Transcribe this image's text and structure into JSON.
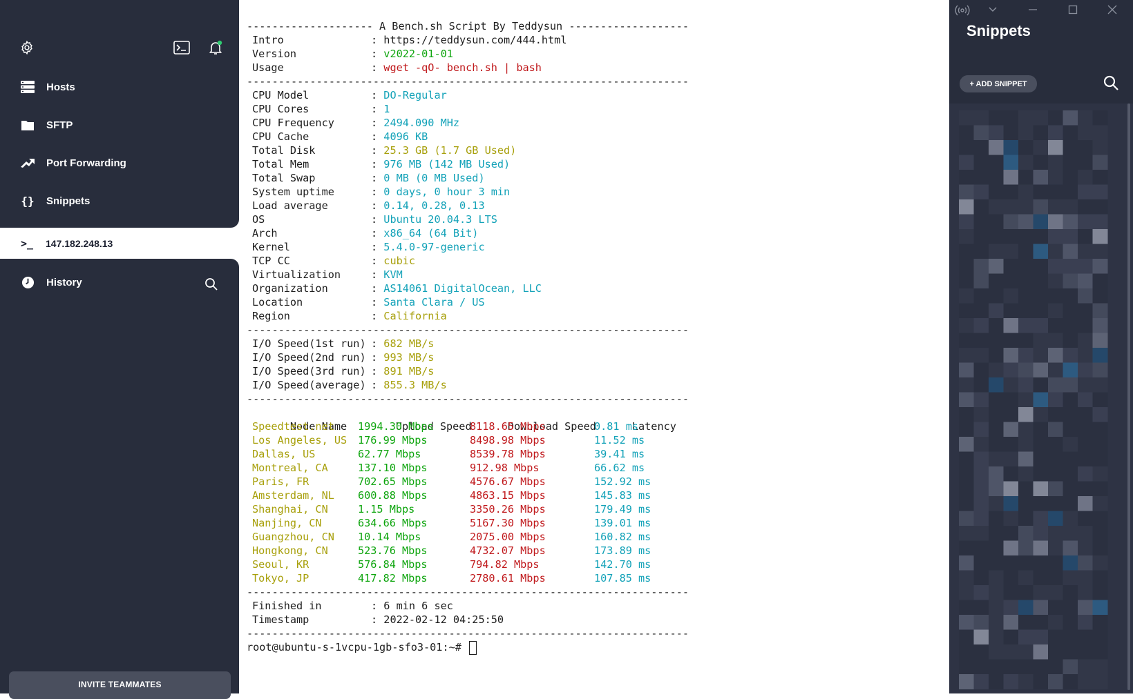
{
  "sidebar": {
    "nav": {
      "hosts": "Hosts",
      "sftp": "SFTP",
      "port_forwarding": "Port Forwarding",
      "snippets": "Snippets",
      "history": "History"
    },
    "active_host": "147.182.248.13",
    "invite_label": "INVITE TEAMMATES",
    "notification_dot_color": "#2ecc71"
  },
  "terminal": {
    "header": "-------------------- A Bench.sh Script By Teddysun -------------------",
    "separator": "----------------------------------------------------------------------",
    "intro": [
      {
        "key": "Intro",
        "value": "https://teddysun.com/444.html",
        "color": "dark"
      },
      {
        "key": "Version",
        "value": "v2022-01-01",
        "color": "green"
      },
      {
        "key": "Usage",
        "value": "wget -qO- bench.sh | bash",
        "color": "red"
      }
    ],
    "system": [
      {
        "key": "CPU Model",
        "value": "DO-Regular",
        "color": "cyan"
      },
      {
        "key": "CPU Cores",
        "value": "1",
        "color": "cyan"
      },
      {
        "key": "CPU Frequency",
        "value": "2494.090 MHz",
        "color": "cyan"
      },
      {
        "key": "CPU Cache",
        "value": "4096 KB",
        "color": "cyan"
      },
      {
        "key": "Total Disk",
        "value": "25.3 GB (1.7 GB Used)",
        "color": "yellow"
      },
      {
        "key": "Total Mem",
        "value": "976 MB (142 MB Used)",
        "color": "cyan"
      },
      {
        "key": "Total Swap",
        "value": "0 MB (0 MB Used)",
        "color": "cyan"
      },
      {
        "key": "System uptime",
        "value": "0 days, 0 hour 3 min",
        "color": "cyan"
      },
      {
        "key": "Load average",
        "value": "0.14, 0.28, 0.13",
        "color": "cyan"
      },
      {
        "key": "OS",
        "value": "Ubuntu 20.04.3 LTS",
        "color": "cyan"
      },
      {
        "key": "Arch",
        "value": "x86_64 (64 Bit)",
        "color": "cyan"
      },
      {
        "key": "Kernel",
        "value": "5.4.0-97-generic",
        "color": "cyan"
      },
      {
        "key": "TCP CC",
        "value": "cubic",
        "color": "yellow"
      },
      {
        "key": "Virtualization",
        "value": "KVM",
        "color": "cyan"
      },
      {
        "key": "Organization",
        "value": "AS14061 DigitalOcean, LLC",
        "color": "cyan"
      },
      {
        "key": "Location",
        "value": "Santa Clara / US",
        "color": "cyan"
      },
      {
        "key": "Region",
        "value": "California",
        "color": "yellow"
      }
    ],
    "io": [
      {
        "key": "I/O Speed(1st run)",
        "value": "682 MB/s",
        "color": "yellow"
      },
      {
        "key": "I/O Speed(2nd run)",
        "value": "993 MB/s",
        "color": "yellow"
      },
      {
        "key": "I/O Speed(3rd run)",
        "value": "891 MB/s",
        "color": "yellow"
      },
      {
        "key": "I/O Speed(average)",
        "value": "855.3 MB/s",
        "color": "yellow"
      }
    ],
    "speed_headers": [
      "Node Name",
      "Upload Speed",
      "Download Speed",
      "Latency"
    ],
    "speed_rows": [
      [
        "Speedtest.net",
        "1994.30 Mbps",
        "8118.65 Mbps",
        "0.81 ms"
      ],
      [
        "Los Angeles, US",
        "176.99 Mbps",
        "8498.98 Mbps",
        "11.52 ms"
      ],
      [
        "Dallas, US",
        "62.77 Mbps",
        "8539.78 Mbps",
        "39.41 ms"
      ],
      [
        "Montreal, CA",
        "137.10 Mbps",
        "912.98 Mbps",
        "66.62 ms"
      ],
      [
        "Paris, FR",
        "702.65 Mbps",
        "4576.67 Mbps",
        "152.92 ms"
      ],
      [
        "Amsterdam, NL",
        "600.88 Mbps",
        "4863.15 Mbps",
        "145.83 ms"
      ],
      [
        "Shanghai, CN",
        "1.15 Mbps",
        "3350.26 Mbps",
        "179.49 ms"
      ],
      [
        "Nanjing, CN",
        "634.66 Mbps",
        "5167.30 Mbps",
        "139.01 ms"
      ],
      [
        "Guangzhou, CN",
        "10.14 Mbps",
        "2075.00 Mbps",
        "160.82 ms"
      ],
      [
        "Hongkong, CN",
        "523.76 Mbps",
        "4732.07 Mbps",
        "173.89 ms"
      ],
      [
        "Seoul, KR",
        "576.84 Mbps",
        "794.82 Mbps",
        "142.70 ms"
      ],
      [
        "Tokyo, JP",
        "417.82 Mbps",
        "2780.61 Mbps",
        "107.85 ms"
      ]
    ],
    "summary": [
      {
        "key": "Finished in",
        "value": "6 min 6 sec",
        "color": "dark"
      },
      {
        "key": "Timestamp",
        "value": "2022-02-12 04:25:50",
        "color": "dark"
      }
    ],
    "prompt": "root@ubuntu-s-1vcpu-1gb-sfo3-01:~#"
  },
  "snippets_panel": {
    "title": "Snippets",
    "add_label": "+ ADD SNIPPET"
  },
  "colors": {
    "sidebar_bg": "#282d3c",
    "term_green": "#0ea50e",
    "term_red": "#c0191c",
    "term_cyan": "#13a2b8",
    "term_yellow": "#a8a00c"
  }
}
